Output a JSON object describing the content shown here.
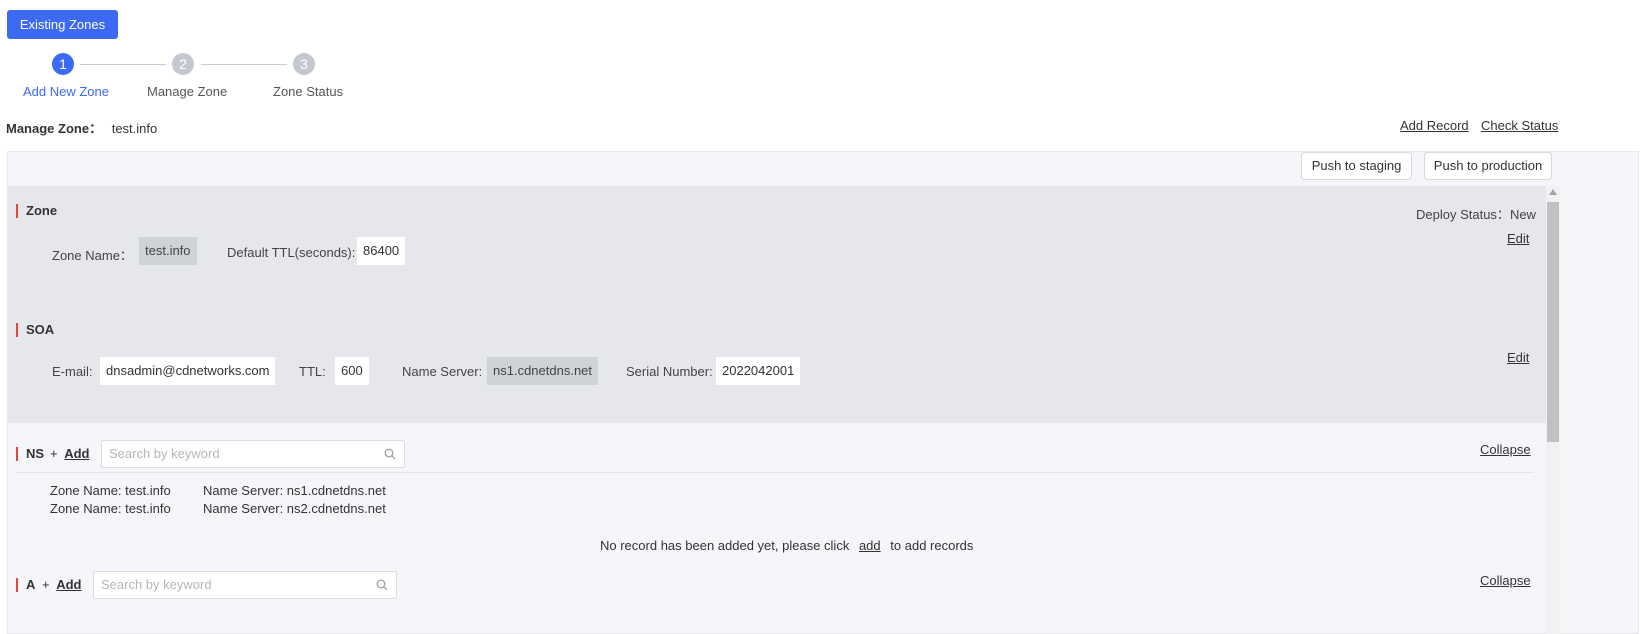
{
  "top_button": "Existing Zones",
  "steps": [
    {
      "number": "1",
      "label": "Add New Zone"
    },
    {
      "number": "2",
      "label": "Manage Zone"
    },
    {
      "number": "3",
      "label": "Zone Status"
    }
  ],
  "manage_zone": {
    "label": "Manage Zone：",
    "value": "test.info",
    "add_record": "Add Record",
    "check_status": "Check Status"
  },
  "toolbar": {
    "push_staging": "Push to staging",
    "push_production": "Push to production"
  },
  "zone": {
    "title": "Zone",
    "deploy_status_label": "Deploy Status：",
    "deploy_status_value": "New",
    "edit": "Edit",
    "zone_name_label": "Zone Name：",
    "zone_name_value": "test.info",
    "ttl_label": "Default TTL(seconds):",
    "ttl_value": "86400"
  },
  "soa": {
    "title": "SOA",
    "edit": "Edit",
    "email_label": "E-mail:",
    "email_value": "dnsadmin@cdnetworks.com",
    "ttl_label": "TTL:",
    "ttl_value": "600",
    "ns_label": "Name Server:",
    "ns_value": "ns1.cdnetdns.net",
    "serial_label": "Serial Number:",
    "serial_value": "2022042001"
  },
  "ns": {
    "title": "NS",
    "add_plus": "+",
    "add": "Add",
    "search_placeholder": "Search by keyword",
    "collapse": "Collapse",
    "records": [
      {
        "zone": "Zone Name: test.info",
        "server": "Name Server: ns1.cdnetdns.net"
      },
      {
        "zone": "Zone Name: test.info",
        "server": "Name Server: ns2.cdnetdns.net"
      }
    ],
    "empty_prefix": "No record has been added yet, please click",
    "empty_link": "add",
    "empty_suffix": "to add records"
  },
  "a": {
    "title": "A",
    "add_plus": "+",
    "add": "Add",
    "search_placeholder": "Search by keyword",
    "collapse": "Collapse"
  },
  "colors": {
    "primary": "#3d6af5",
    "step_inactive": "#c3c7cf",
    "accent_bar": "#e3483e"
  }
}
